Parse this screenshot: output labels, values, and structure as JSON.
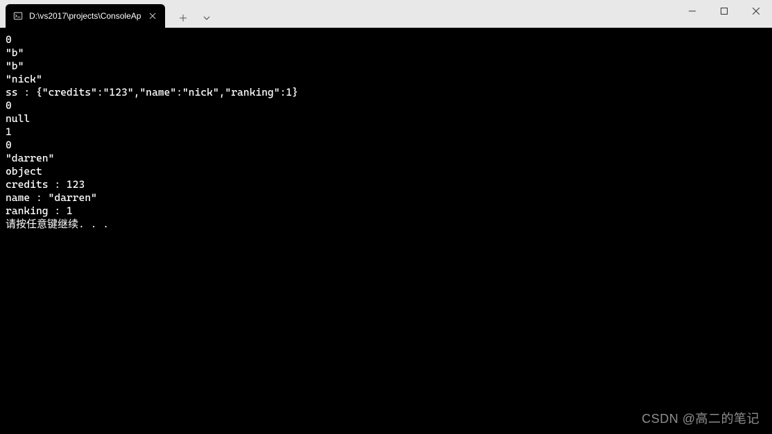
{
  "tab": {
    "title": "D:\\vs2017\\projects\\ConsoleAp"
  },
  "console": {
    "lines": [
      "0",
      "\"b\"",
      "\"b\"",
      "\"nick\"",
      "ss : {\"credits\":\"123\",\"name\":\"nick\",\"ranking\":1}",
      "0",
      "null",
      "1",
      "0",
      "\"darren\"",
      "object",
      "credits : 123",
      "name : \"darren\"",
      "ranking : 1",
      "请按任意键继续. . ."
    ]
  },
  "watermark": "CSDN @高二的笔记"
}
